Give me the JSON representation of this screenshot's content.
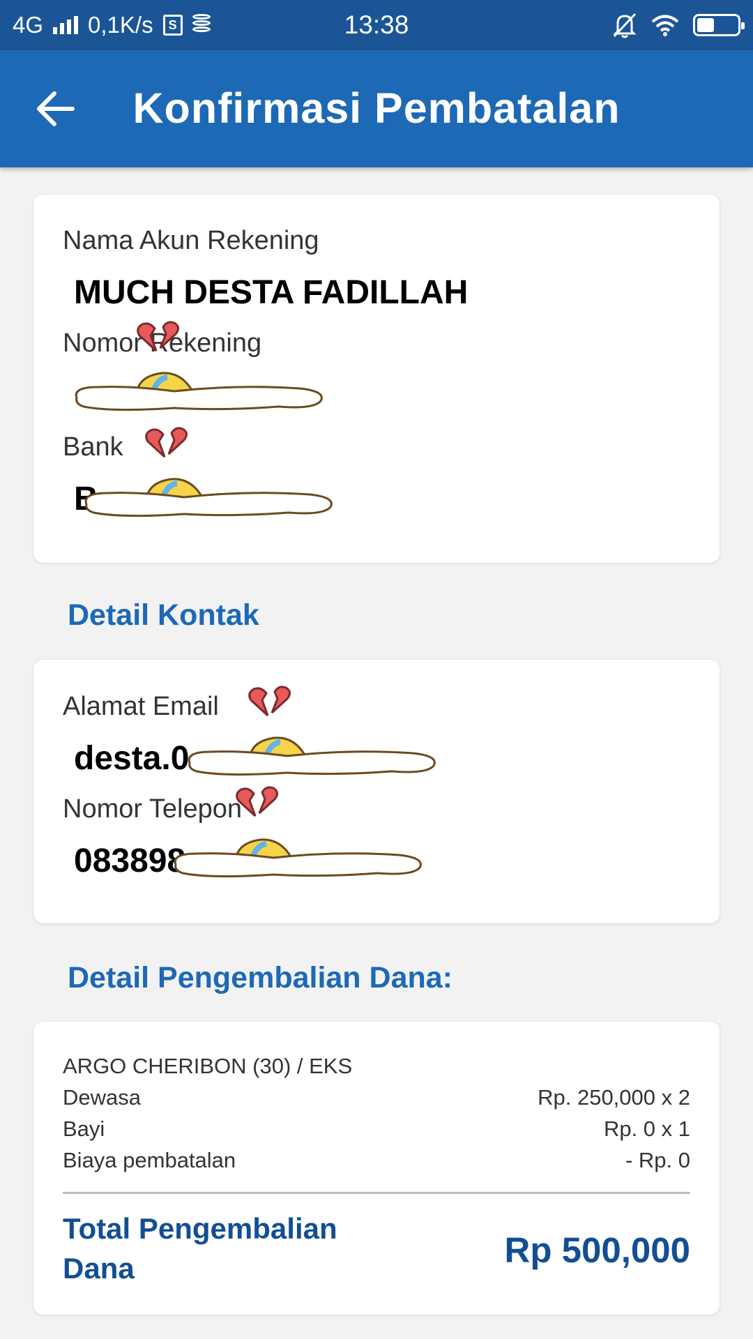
{
  "status_bar": {
    "network": "4G",
    "speed": "0,1K/s",
    "time": "13:38"
  },
  "header": {
    "title": "Konfirmasi Pembatalan"
  },
  "account": {
    "name_label": "Nama Akun Rekening",
    "name_value": "MUCH DESTA FADILLAH",
    "number_label": "Nomor Rekening",
    "number_value": "",
    "bank_label": "Bank",
    "bank_value": "B"
  },
  "contact_section": {
    "title": "Detail Kontak",
    "email_label": "Alamat Email",
    "email_value": "desta.0",
    "phone_label": "Nomor Telepon",
    "phone_value": "083898"
  },
  "refund_section": {
    "title": "Detail Pengembalian Dana:",
    "train": "ARGO CHERIBON (30) / EKS",
    "rows": [
      {
        "label": "Dewasa",
        "value": "Rp. 250,000 x 2"
      },
      {
        "label": "Bayi",
        "value": "Rp. 0 x 1"
      },
      {
        "label": "Biaya pembatalan",
        "value": "- Rp. 0"
      }
    ],
    "total_label": "Total Pengembalian Dana",
    "total_value": "Rp 500,000"
  },
  "colors": {
    "status_bar": "#1b5596",
    "app_bar": "#1d69b5",
    "accent_text": "#1d69b5",
    "total_text": "#124f92",
    "background": "#f2f2f2"
  },
  "icons": [
    "back-arrow-icon",
    "signal-icon",
    "sim-icon",
    "database-icon",
    "mute-bell-icon",
    "wifi-icon",
    "battery-icon"
  ]
}
